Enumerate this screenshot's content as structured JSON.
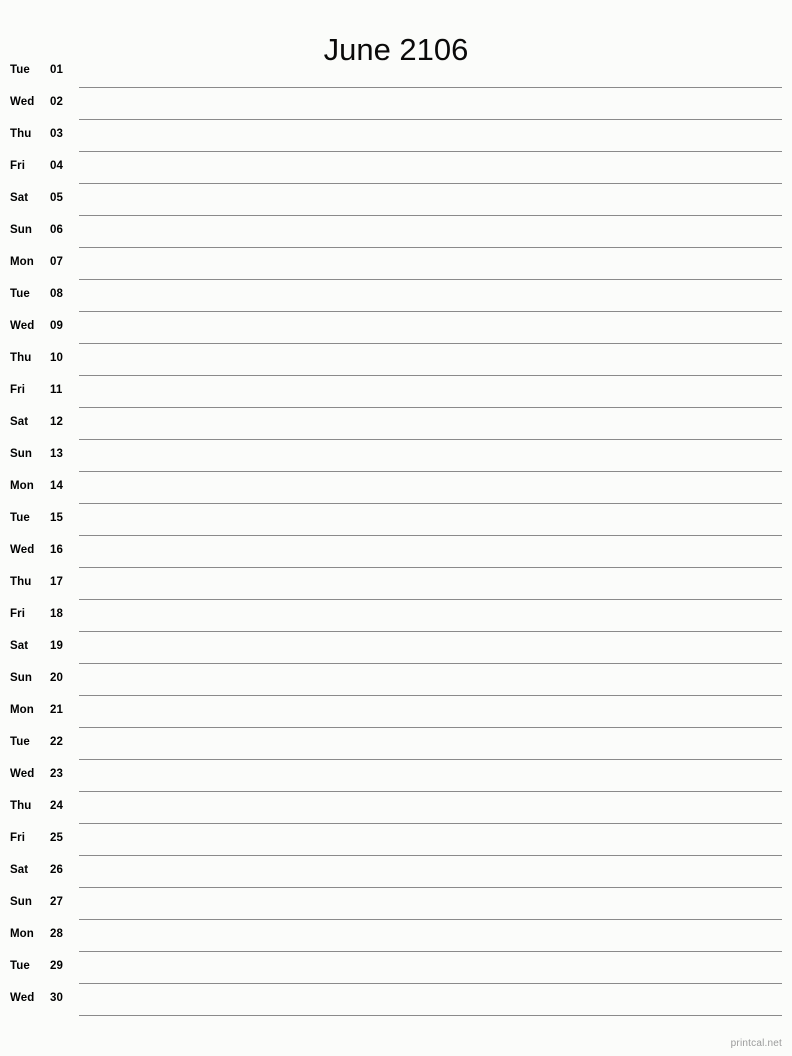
{
  "page": {
    "title": "June 2106",
    "background_color": "#fbfcfa",
    "line_color": "#8a8a8a",
    "text_color": "#000000"
  },
  "calendar": {
    "month": "June",
    "year": "2106",
    "days": [
      {
        "weekday": "Tue",
        "number": "01"
      },
      {
        "weekday": "Wed",
        "number": "02"
      },
      {
        "weekday": "Thu",
        "number": "03"
      },
      {
        "weekday": "Fri",
        "number": "04"
      },
      {
        "weekday": "Sat",
        "number": "05"
      },
      {
        "weekday": "Sun",
        "number": "06"
      },
      {
        "weekday": "Mon",
        "number": "07"
      },
      {
        "weekday": "Tue",
        "number": "08"
      },
      {
        "weekday": "Wed",
        "number": "09"
      },
      {
        "weekday": "Thu",
        "number": "10"
      },
      {
        "weekday": "Fri",
        "number": "11"
      },
      {
        "weekday": "Sat",
        "number": "12"
      },
      {
        "weekday": "Sun",
        "number": "13"
      },
      {
        "weekday": "Mon",
        "number": "14"
      },
      {
        "weekday": "Tue",
        "number": "15"
      },
      {
        "weekday": "Wed",
        "number": "16"
      },
      {
        "weekday": "Thu",
        "number": "17"
      },
      {
        "weekday": "Fri",
        "number": "18"
      },
      {
        "weekday": "Sat",
        "number": "19"
      },
      {
        "weekday": "Sun",
        "number": "20"
      },
      {
        "weekday": "Mon",
        "number": "21"
      },
      {
        "weekday": "Tue",
        "number": "22"
      },
      {
        "weekday": "Wed",
        "number": "23"
      },
      {
        "weekday": "Thu",
        "number": "24"
      },
      {
        "weekday": "Fri",
        "number": "25"
      },
      {
        "weekday": "Sat",
        "number": "26"
      },
      {
        "weekday": "Sun",
        "number": "27"
      },
      {
        "weekday": "Mon",
        "number": "28"
      },
      {
        "weekday": "Tue",
        "number": "29"
      },
      {
        "weekday": "Wed",
        "number": "30"
      }
    ]
  },
  "footer": {
    "attribution": "printcal.net"
  }
}
